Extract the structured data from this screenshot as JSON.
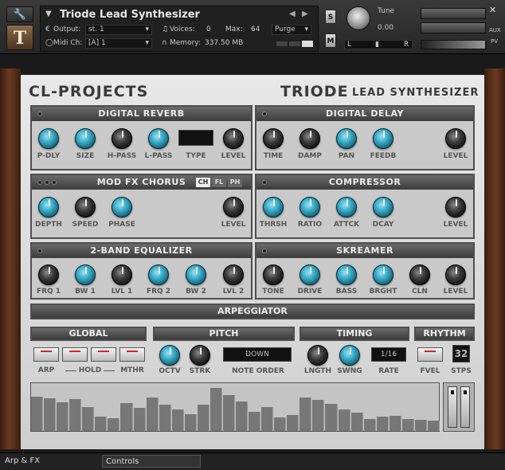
{
  "header": {
    "tool_icon": "wrench-icon",
    "logo_letter": "T",
    "instrument_name": "Triode Lead Synthesizer",
    "output_label": "Output:",
    "output_value": "st. 1",
    "voices_label": "Voices:",
    "voices_value": "0",
    "max_label": "Max:",
    "max_value": "64",
    "purge_label": "Purge",
    "midi_label": "Midi Ch:",
    "midi_value": "[A] 1",
    "memory_label": "Memory:",
    "memory_value": "337.50 MB",
    "solo_label": "S",
    "mute_label": "M",
    "tune_label": "Tune",
    "tune_value": "0.00",
    "pan_left": "L",
    "pan_right": "R",
    "aux_label": "AUX",
    "pv_label": "PV"
  },
  "panel": {
    "brand": "CL-PROJECTS",
    "product_big": "TRIODE",
    "product_small": "LEAD SYNTHESIZER"
  },
  "sections": {
    "reverb": {
      "title": "DIGITAL REVERB",
      "knobs": [
        "P-DLY",
        "SIZE",
        "H-PASS",
        "L-PASS"
      ],
      "type_label": "TYPE",
      "level": "LEVEL"
    },
    "delay": {
      "title": "DIGITAL DELAY",
      "knobs": [
        "TIME",
        "DAMP",
        "PAN",
        "FEEDB"
      ],
      "level": "LEVEL"
    },
    "chorus": {
      "title": "MOD FX CHORUS",
      "modes": [
        "CH",
        "FL",
        "PH"
      ],
      "knobs": [
        "DEPTH",
        "SPEED",
        "PHASE"
      ],
      "level": "LEVEL"
    },
    "compressor": {
      "title": "COMPRESSOR",
      "knobs": [
        "THRSH",
        "RATIO",
        "ATTCK",
        "DCAY"
      ],
      "level": "LEVEL"
    },
    "eq": {
      "title": "2-BAND EQUALIZER",
      "knobs": [
        "FRQ 1",
        "BW 1",
        "LVL 1",
        "FRQ 2",
        "BW 2",
        "LVL 2"
      ]
    },
    "skreamer": {
      "title": "SKREAMER",
      "knobs": [
        "TONE",
        "DRIVE",
        "BASS",
        "BRGHT",
        "CLN",
        "LEVEL"
      ]
    }
  },
  "arp": {
    "title": "ARPEGGIATOR",
    "global": {
      "title": "GLOBAL",
      "arp": "ARP",
      "hold": "HOLD",
      "mthr": "MTHR"
    },
    "pitch": {
      "title": "PITCH",
      "octv": "OCTV",
      "strk": "STRK",
      "order_value": "DOWN",
      "order_label": "NOTE ORDER"
    },
    "timing": {
      "title": "TIMING",
      "lngth": "LNGTH",
      "swng": "SWNG",
      "rate_value": "1/16",
      "rate_label": "RATE"
    },
    "rhythm": {
      "title": "RHYTHM",
      "fvel": "FVEL",
      "steps_value": "32",
      "steps_label": "STPS"
    },
    "step_levels": [
      0.72,
      0.68,
      0.6,
      0.66,
      0.5,
      0.3,
      0.26,
      0.58,
      0.48,
      0.7,
      0.55,
      0.45,
      0.35,
      0.55,
      0.9,
      0.75,
      0.62,
      0.4,
      0.5,
      0.28,
      0.33,
      0.7,
      0.65,
      0.57,
      0.45,
      0.38,
      0.25,
      0.3,
      0.32,
      0.25,
      0.23,
      0.22
    ]
  },
  "footer": {
    "tab1": "Arp & FX",
    "tab2": "Controls"
  }
}
